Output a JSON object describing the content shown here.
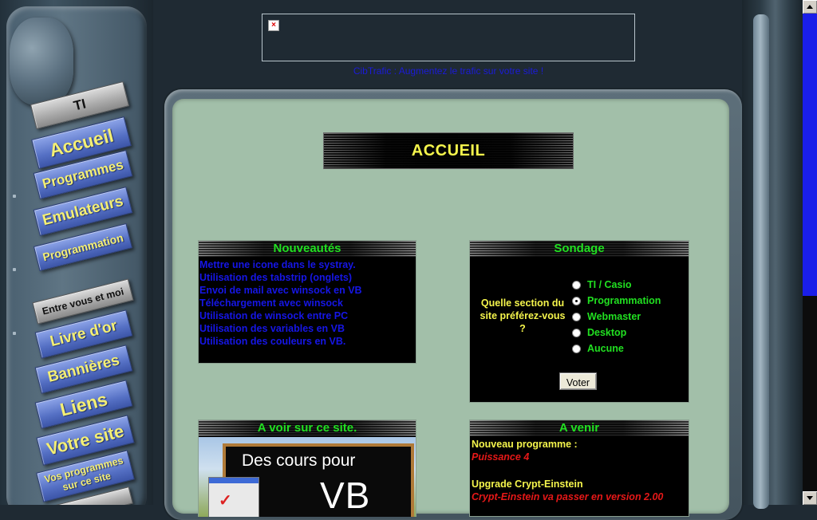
{
  "nav": {
    "section_ti": "TI",
    "accueil": "Accueil",
    "programmes": "Programmes",
    "emulateurs": "Emulateurs",
    "programmation": "Programmation",
    "section_entre": "Entre vous et moi",
    "livre": "Livre d'or",
    "bannieres": "Bannières",
    "liens": "Liens",
    "votre_site": "Votre site",
    "vos_programmes_1": "Vos programmes",
    "vos_programmes_2": "sur ce site"
  },
  "banner": {
    "link_text": "CibTrafic : Augmentez le trafic sur votre site !",
    "broken_icon": "broken-image-icon"
  },
  "page": {
    "title": "ACCUEIL"
  },
  "news": {
    "title": "Nouveautés",
    "items": [
      "Mettre une icone dans le systray.",
      "Utilisation des tabstrip (onglets)",
      "Envoi de mail avec winsock en VB",
      "Téléchargement avec winsock",
      "Utilisation de winsock entre PC",
      "Utilisation des variables en VB",
      "Utilisation des couleurs en VB."
    ]
  },
  "poll": {
    "title": "Sondage",
    "question": "Quelle section du site préférez-vous ?",
    "options": [
      "TI / Casio",
      "Programmation",
      "Webmaster",
      "Desktop",
      "Aucune"
    ],
    "selected": "Programmation",
    "vote_label": "Voter"
  },
  "promo": {
    "title": "A voir sur ce site.",
    "image_text_1": "Des cours pour",
    "image_text_2": "VB"
  },
  "upcoming": {
    "title": "A venir",
    "items": [
      {
        "heading": "Nouveau programme :",
        "detail": "Puissance 4"
      },
      {
        "heading": "Upgrade Crypt-Einstein",
        "detail": "Crypt-Einstein va passer en version 2.00"
      }
    ]
  },
  "colors": {
    "screen_bg": "#a2bfa9",
    "title_yellow": "#f5f54c",
    "panel_green": "#21e021",
    "link_blue": "#1616e6",
    "alert_red": "#e61818",
    "scroll_thumb": "#1a1ee8"
  }
}
